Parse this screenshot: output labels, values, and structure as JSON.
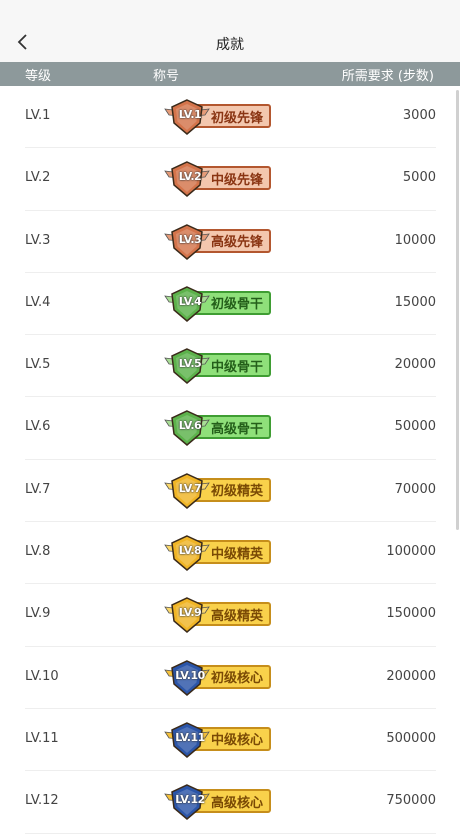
{
  "page": {
    "title": "成就"
  },
  "table": {
    "headers": {
      "level": "等级",
      "title": "称号",
      "requirement": "所需要求 (步数)"
    },
    "rows": [
      {
        "level": "LV.1",
        "badge_num": "LV.1",
        "badge_label": "初级先锋",
        "requirement": "3000",
        "tier": "bronze"
      },
      {
        "level": "LV.2",
        "badge_num": "LV.2",
        "badge_label": "中级先锋",
        "requirement": "5000",
        "tier": "bronze"
      },
      {
        "level": "LV.3",
        "badge_num": "LV.3",
        "badge_label": "高级先锋",
        "requirement": "10000",
        "tier": "bronze"
      },
      {
        "level": "LV.4",
        "badge_num": "LV.4",
        "badge_label": "初级骨干",
        "requirement": "15000",
        "tier": "green"
      },
      {
        "level": "LV.5",
        "badge_num": "LV.5",
        "badge_label": "中级骨干",
        "requirement": "20000",
        "tier": "green"
      },
      {
        "level": "LV.6",
        "badge_num": "LV.6",
        "badge_label": "高级骨干",
        "requirement": "50000",
        "tier": "green"
      },
      {
        "level": "LV.7",
        "badge_num": "LV.7",
        "badge_label": "初级精英",
        "requirement": "70000",
        "tier": "gold"
      },
      {
        "level": "LV.8",
        "badge_num": "LV.8",
        "badge_label": "中级精英",
        "requirement": "100000",
        "tier": "gold"
      },
      {
        "level": "LV.9",
        "badge_num": "LV.9",
        "badge_label": "高级精英",
        "requirement": "150000",
        "tier": "gold"
      },
      {
        "level": "LV.10",
        "badge_num": "LV.10",
        "badge_label": "初级核心",
        "requirement": "200000",
        "tier": "blue"
      },
      {
        "level": "LV.11",
        "badge_num": "LV.11",
        "badge_label": "中级核心",
        "requirement": "500000",
        "tier": "blue"
      },
      {
        "level": "LV.12",
        "badge_num": "LV.12",
        "badge_label": "高级核心",
        "requirement": "750000",
        "tier": "blue"
      }
    ]
  },
  "tiers": {
    "bronze": {
      "plate": "#f3c7ae",
      "plate_border": "#b3572f",
      "plate_text": "#8a3513",
      "shield": "#d4744b",
      "wing": "#e59b78"
    },
    "green": {
      "plate": "#8fe07a",
      "plate_border": "#3f9d33",
      "plate_text": "#245f1a",
      "shield": "#5cb24b",
      "wing": "#a8dd95"
    },
    "gold": {
      "plate": "#f9d14b",
      "plate_border": "#c68e1b",
      "plate_text": "#7a4a05",
      "shield": "#f0b526",
      "wing": "#fbd86a"
    },
    "blue": {
      "plate": "#f9d14b",
      "plate_border": "#c68e1b",
      "plate_text": "#7a4a05",
      "shield": "#2b55a8",
      "wing": "#f5c13b"
    }
  },
  "icons": {
    "back": "chevron-left-icon"
  }
}
